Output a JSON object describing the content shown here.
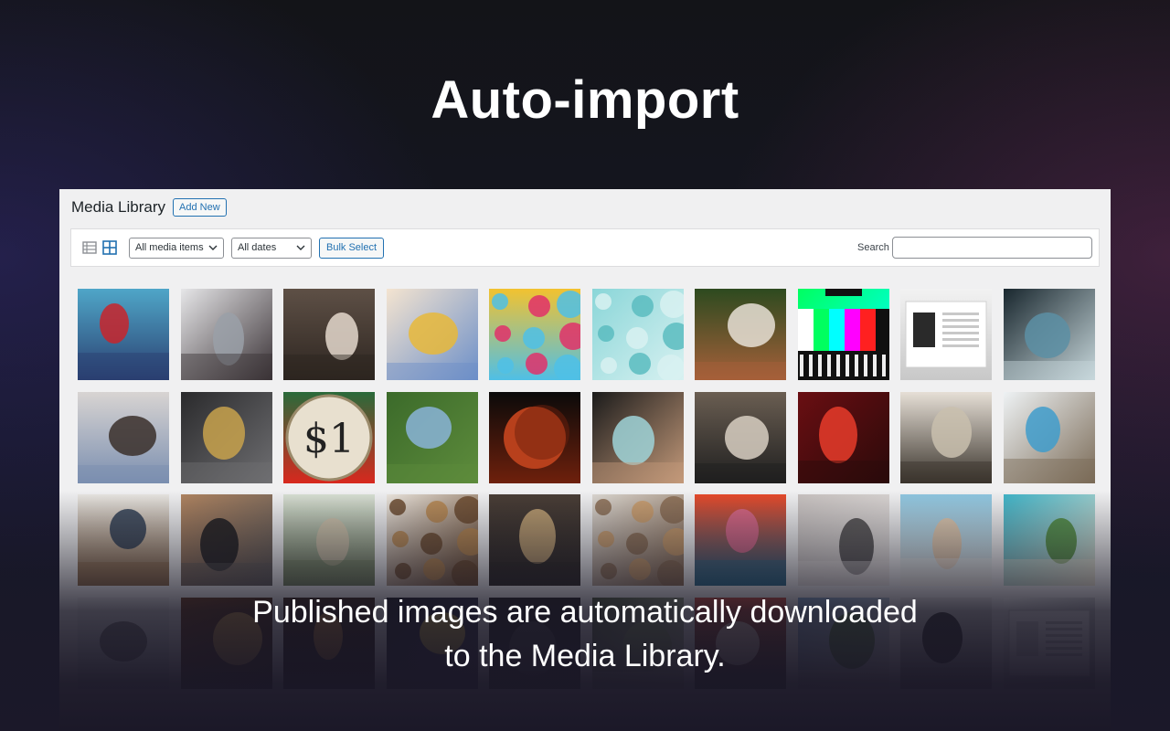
{
  "hero": {
    "title": "Auto-import"
  },
  "media_library": {
    "heading": "Media Library",
    "add_new_label": "Add New",
    "filter_type": "All media items",
    "filter_date": "All dates",
    "bulk_select_label": "Bulk Select",
    "search_label": "Search",
    "search_value": ""
  },
  "caption": {
    "line1": "Published images are automatically downloaded",
    "line2": "to the Media Library."
  },
  "thumbnails": [
    {
      "subject": "man-red-sweater",
      "colors": [
        "#4fa6c8",
        "#c8242c",
        "#2a3f70"
      ]
    },
    {
      "subject": "laptop-hands",
      "colors": [
        "#e6e6e8",
        "#9aa0a8",
        "#3a3236"
      ]
    },
    {
      "subject": "woman-portrait",
      "colors": [
        "#5e5046",
        "#e4d8cc",
        "#2d2520"
      ]
    },
    {
      "subject": "illustration-climbers",
      "colors": [
        "#f4e4d0",
        "#e8b83a",
        "#6c8fc8"
      ]
    },
    {
      "subject": "colorful-bubbles",
      "colors": [
        "#f2c230",
        "#e0306a",
        "#4fbfe6"
      ]
    },
    {
      "subject": "teal-beads",
      "colors": [
        "#8ad6d8",
        "#5bbcc0",
        "#d8f1f1"
      ]
    },
    {
      "subject": "white-rabbit",
      "colors": [
        "#2d4a1f",
        "#e8e1d6",
        "#a6603a"
      ]
    },
    {
      "subject": "test-pattern",
      "colors": [
        "#00ff60",
        "#ff00ff",
        "#00ffff"
      ]
    },
    {
      "subject": "screenshot-page",
      "colors": [
        "#f2f2f2",
        "#2a2a2a",
        "#c8c8c8"
      ]
    },
    {
      "subject": "robot-woman",
      "colors": [
        "#19272e",
        "#5c8fa4",
        "#c8d8dc"
      ]
    },
    {
      "subject": "couple-hug",
      "colors": [
        "#d8d4d2",
        "#3a2f2a",
        "#7b8fb0"
      ]
    },
    {
      "subject": "gold-rings",
      "colors": [
        "#2a2a2c",
        "#c8a24c",
        "#6f6f72"
      ]
    },
    {
      "subject": "dollar-coin",
      "colors": [
        "#2a6a3a",
        "#e8e0cf",
        "#d8281e"
      ]
    },
    {
      "subject": "green-ridge",
      "colors": [
        "#3b6a2a",
        "#8ab4d8",
        "#5e8c3c"
      ]
    },
    {
      "subject": "blood-moon",
      "colors": [
        "#0a0a0a",
        "#b8401c",
        "#6e200c"
      ]
    },
    {
      "subject": "masked-woman",
      "colors": [
        "#1b1b1b",
        "#9fd4d8",
        "#c49a7a"
      ]
    },
    {
      "subject": "guitarist-warehouse",
      "colors": [
        "#6a5e52",
        "#d8cfc2",
        "#1f1f1f"
      ]
    },
    {
      "subject": "vr-headset",
      "colors": [
        "#6a0e12",
        "#e83c2a",
        "#2a0a0a"
      ]
    },
    {
      "subject": "bedside-vase",
      "colors": [
        "#e6dfd6",
        "#c9bfae",
        "#3a342c"
      ]
    },
    {
      "subject": "blue-van",
      "colors": [
        "#eef2f4",
        "#3f9ccb",
        "#7a6a56"
      ]
    },
    {
      "subject": "man-laptop-hat",
      "colors": [
        "#e8e6e2",
        "#2f3e54",
        "#8c6a48"
      ]
    },
    {
      "subject": "camera-gear",
      "colors": [
        "#b08460",
        "#1c1c1e",
        "#5e5a58"
      ]
    },
    {
      "subject": "kitten",
      "colors": [
        "#d8e0d4",
        "#cdbfa8",
        "#6f7f5c"
      ]
    },
    {
      "subject": "cookies",
      "colors": [
        "#ece6de",
        "#b5854e",
        "#6b4a2e"
      ]
    },
    {
      "subject": "train-street",
      "colors": [
        "#4a3e36",
        "#c8a878",
        "#2a2624"
      ]
    },
    {
      "subject": "cereal-bowl",
      "colors": [
        "#dcd8d2",
        "#c89a68",
        "#8a6c52"
      ]
    },
    {
      "subject": "woman-lollipop",
      "colors": [
        "#e84a2a",
        "#d86a8e",
        "#2a6a8a"
      ]
    },
    {
      "subject": "sleeping-cat",
      "colors": [
        "#c8c2c0",
        "#4a4848",
        "#e8e4e2"
      ]
    },
    {
      "subject": "girl-bed",
      "colors": [
        "#8ec6e0",
        "#e6c8a8",
        "#f2f0ec"
      ]
    },
    {
      "subject": "tropical-pool",
      "colors": [
        "#3fb4c8",
        "#4f8a3a",
        "#e8e2d0"
      ]
    },
    {
      "subject": "desk-setup",
      "colors": [
        "#e8e8e8",
        "#6a6a6a",
        "#cfd8de"
      ]
    },
    {
      "subject": "pizza",
      "colors": [
        "#6a3a1c",
        "#d8a44c",
        "#2a1c10"
      ]
    },
    {
      "subject": "guitar",
      "colors": [
        "#3a2418",
        "#c8883a",
        "#1a1210"
      ]
    },
    {
      "subject": "concert",
      "colors": [
        "#1a1a24",
        "#e8c84c",
        "#3a3a5a"
      ]
    },
    {
      "subject": "dark-room",
      "colors": [
        "#1e1e20",
        "#4a4a4e",
        "#2e2e30"
      ]
    },
    {
      "subject": "landscape",
      "colors": [
        "#4a5a3a",
        "#8aa06a",
        "#c8d0b8"
      ]
    },
    {
      "subject": "fashion",
      "colors": [
        "#c84a3a",
        "#e8d4c8",
        "#2a2a2a"
      ]
    },
    {
      "subject": "golfer",
      "colors": [
        "#7aa0c8",
        "#4f7a3a",
        "#e8e4dc"
      ]
    },
    {
      "subject": "white-car",
      "colors": [
        "#e4e4e4",
        "#1a1a1a",
        "#8a8a8a"
      ]
    },
    {
      "subject": "document-placeholder",
      "colors": [
        "#f6f7f7",
        "#dcdcde",
        "#a7aaad"
      ]
    }
  ]
}
